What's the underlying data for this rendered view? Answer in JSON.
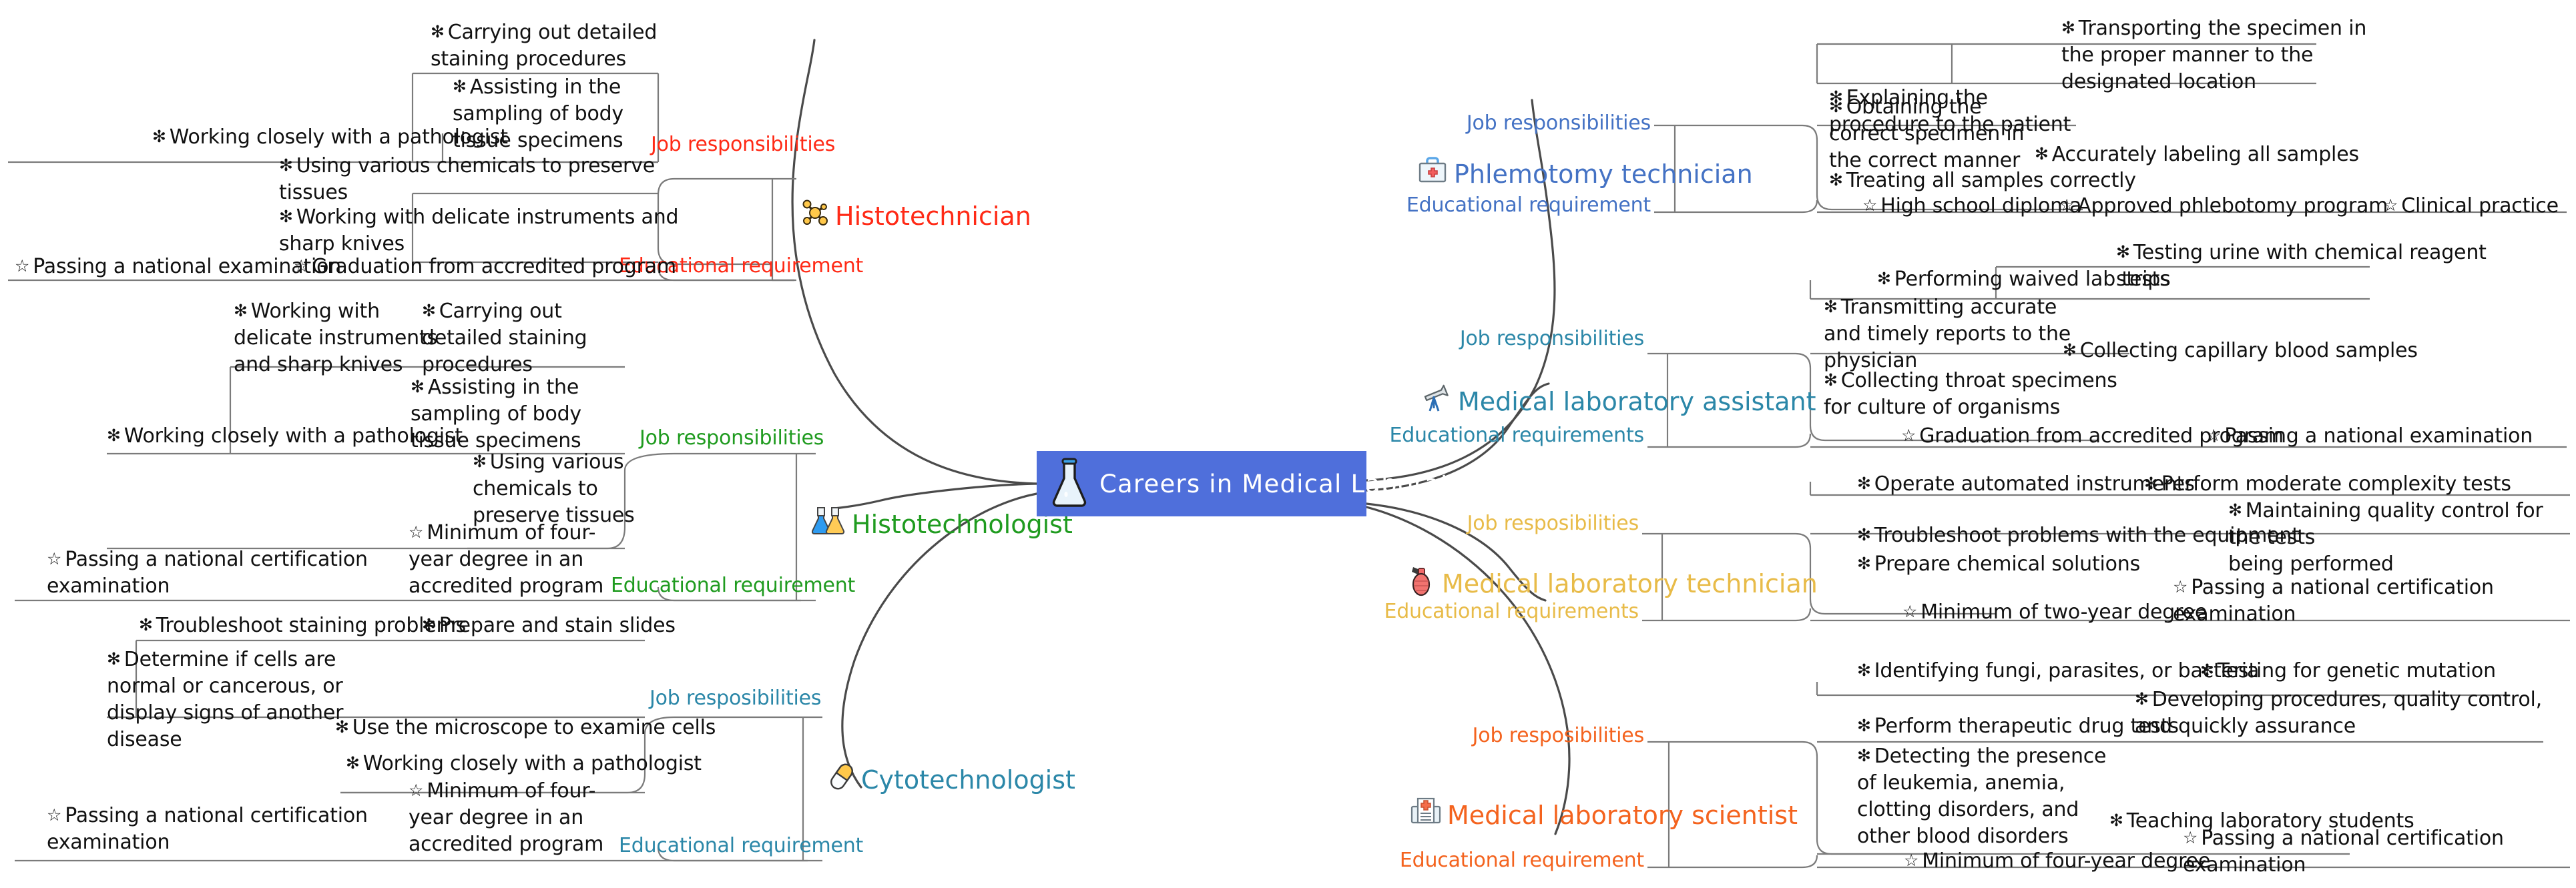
{
  "center": {
    "title": "Careers in Medical Laboratories",
    "icon": "flask-icon",
    "bg_color": "#4f6fdb",
    "text_color": "#ffffff"
  },
  "bullets": {
    "item": "✻",
    "requirement": "☆"
  },
  "branches": [
    {
      "id": "histotechnician",
      "label": "Histotechnician",
      "icon": "molecule-icon",
      "color": "#ff2a16",
      "side": "left",
      "categories": [
        {
          "id": "job-responsibilities",
          "label": "Job responsibilities",
          "items": [
            "Carrying out detailed\nstaining procedures",
            "Assisting in the\nsampling of body\ntissue specimens",
            "Working closely with a pathologist",
            "Using various chemicals to preserve\ntissues",
            "Working with delicate instruments and\nsharp knives"
          ]
        },
        {
          "id": "educational-requirement",
          "label": "Educational requirement",
          "items": [
            "Passing a national examination",
            "Graduation from accredited program"
          ]
        }
      ]
    },
    {
      "id": "histotechnologist",
      "label": "Histotechnologist",
      "icon": "two-flasks-icon",
      "color": "#1f9b1f",
      "side": "left",
      "categories": [
        {
          "id": "job-responsibilities",
          "label": "Job responsibilities",
          "items": [
            "Working with\ndelicate instruments\nand sharp knives",
            "Carrying out\ndetailed staining\nprocedures",
            "Assisting in the\nsampling of body\ntissue specimens",
            "Working closely with a pathologist",
            "Using various\nchemicals to\npreserve tissues"
          ]
        },
        {
          "id": "educational-requirement",
          "label": "Educational requirement",
          "items": [
            "Passing a national certification\nexamination",
            "Minimum of four-\nyear degree in an\naccredited program"
          ]
        }
      ]
    },
    {
      "id": "cytotechnologist",
      "label": "Cytotechnologist",
      "icon": "capsule-icon",
      "color": "#2b87a8",
      "side": "left",
      "categories": [
        {
          "id": "job-resposibilities",
          "label": "Job resposibilities",
          "items": [
            "Troubleshoot staining problems",
            "Prepare and stain slides",
            "Determine if cells are\nnormal or cancerous, or\ndisplay signs of another\ndisease",
            "Use the microscope to examine cells",
            "Working closely with a pathologist"
          ]
        },
        {
          "id": "educational-requirement",
          "label": "Educational requirement",
          "items": [
            "Passing a national certification\nexamination",
            "Minimum of four-\nyear degree in an\naccredited program"
          ]
        }
      ]
    },
    {
      "id": "phlemotomy-technician",
      "label": "Phlemotomy technician",
      "icon": "first-aid-kit-icon",
      "color": "#4472c4",
      "side": "right",
      "categories": [
        {
          "id": "job-responsibilities",
          "label": "Job responsibilities",
          "items": [
            "Explaining the\nprocedure to the patient",
            "Transporting the specimen in\nthe proper manner to the\ndesignated location",
            "Obtaining the\ncorrect specimen in\nthe correct manner",
            "Accurately labeling all samples",
            "Treating all samples correctly"
          ]
        },
        {
          "id": "educational-requirement",
          "label": "Educational requirement",
          "items": [
            "High school diploma",
            "Approved phlebotomy program",
            "Clinical practice"
          ]
        }
      ]
    },
    {
      "id": "medical-laboratory-assistant",
      "label": "Medical laboratory assistant",
      "icon": "telescope-icon",
      "color": "#2b87a8",
      "side": "right",
      "categories": [
        {
          "id": "job-responsibilities",
          "label": "Job responsibilities",
          "items": [
            "Performing waived lab tests",
            "Testing urine with chemical reagent\nstrips",
            "Transmitting accurate\nand timely reports to the\nphysician",
            "Collecting capillary blood samples",
            "Collecting throat specimens\nfor culture of organisms"
          ]
        },
        {
          "id": "educational-requirements",
          "label": "Educational requirements",
          "items": [
            "Graduation from accredited program",
            "Passing a national examination"
          ]
        }
      ]
    },
    {
      "id": "medical-laboratory-technician",
      "label": "Medical laboratory technician",
      "icon": "pipette-bulb-icon",
      "color": "#e8bb48",
      "side": "right",
      "categories": [
        {
          "id": "job-resposibilities",
          "label": "Job resposibilities",
          "items": [
            "Operate automated instruments",
            "Perform moderate complexity tests",
            "Troubleshoot problems with the equipment",
            "Maintaining quality control for the tests\nbeing performed",
            "Prepare chemical solutions"
          ]
        },
        {
          "id": "educational-requirements",
          "label": "Educational requirements",
          "items": [
            "Minimum of two-year degree",
            "Passing a national certification\nexamination"
          ]
        }
      ]
    },
    {
      "id": "medical-laboratory-scientist",
      "label": "Medical laboratory scientist",
      "icon": "medical-report-icon",
      "color": "#f4631e",
      "side": "right",
      "categories": [
        {
          "id": "job-resposibilities",
          "label": "Job resposibilities",
          "items": [
            "Identifying fungi, parasites, or bacteria",
            "Testing for genetic mutation",
            "Perform therapeutic drug tests",
            "Developing procedures, quality control,\nand quickly assurance",
            "Detecting the presence\nof leukemia, anemia,\nclotting disorders, and\nother blood disorders",
            "Teaching laboratory students"
          ]
        },
        {
          "id": "educational-requirement",
          "label": "Educational requirement",
          "items": [
            "Minimum of four-year degree",
            "Passing a national certification\nexamination"
          ]
        }
      ]
    }
  ]
}
